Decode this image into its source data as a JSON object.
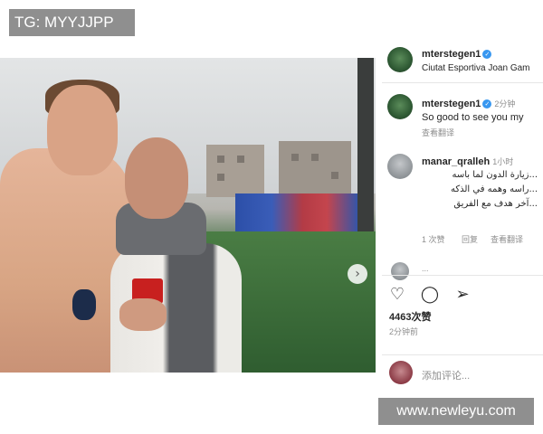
{
  "watermark_top": "TG: MYYJJPP",
  "watermark_bottom": "www.newleyu.com",
  "post": {
    "owner": {
      "username": "mterstegen1",
      "location": "Ciutat Esportiva Joan Gam"
    },
    "caption": {
      "username": "mterstegen1",
      "time": "2分钟",
      "text": "So good to see you my",
      "translate": "查看翻译"
    },
    "comments": [
      {
        "username": "manar_qralleh",
        "time": "1小时",
        "lines": [
          "...زيارة الدون لما باسه",
          "...راسه وهمه في الذكه",
          "...آخر هدف مع الفريق"
        ],
        "meta": [
          "1 次赞",
          "回复",
          "查看翻译"
        ]
      }
    ],
    "partial_next_comment": "...",
    "likes": "4463次赞",
    "post_time": "2分钟前",
    "add_comment_placeholder": "添加评论..."
  },
  "icons": {
    "like": "heart-icon",
    "comment": "comment-icon",
    "share": "send-icon",
    "next": "chevron-right-icon"
  }
}
